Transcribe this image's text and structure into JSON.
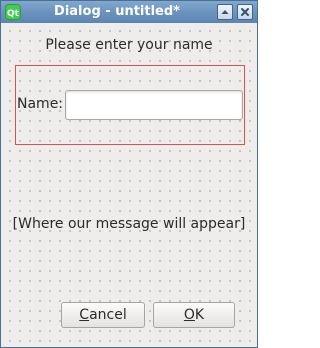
{
  "window": {
    "title": "Dialog - untitled*",
    "app_icon": "qt-icon",
    "controls": [
      "maximize-icon",
      "close-icon"
    ]
  },
  "form": {
    "prompt": "Please enter your name",
    "name_label": "Name:",
    "name_value": "",
    "name_placeholder": ""
  },
  "message": "[Where our message will appear]",
  "buttons": {
    "cancel": {
      "mnemonic": "C",
      "rest": "ancel"
    },
    "ok": {
      "mnemonic": "O",
      "rest": "K"
    }
  },
  "colors": {
    "titlebar": "#6b93bd",
    "layout_frame": "#d9534f",
    "client_background": "#eeedeb"
  }
}
